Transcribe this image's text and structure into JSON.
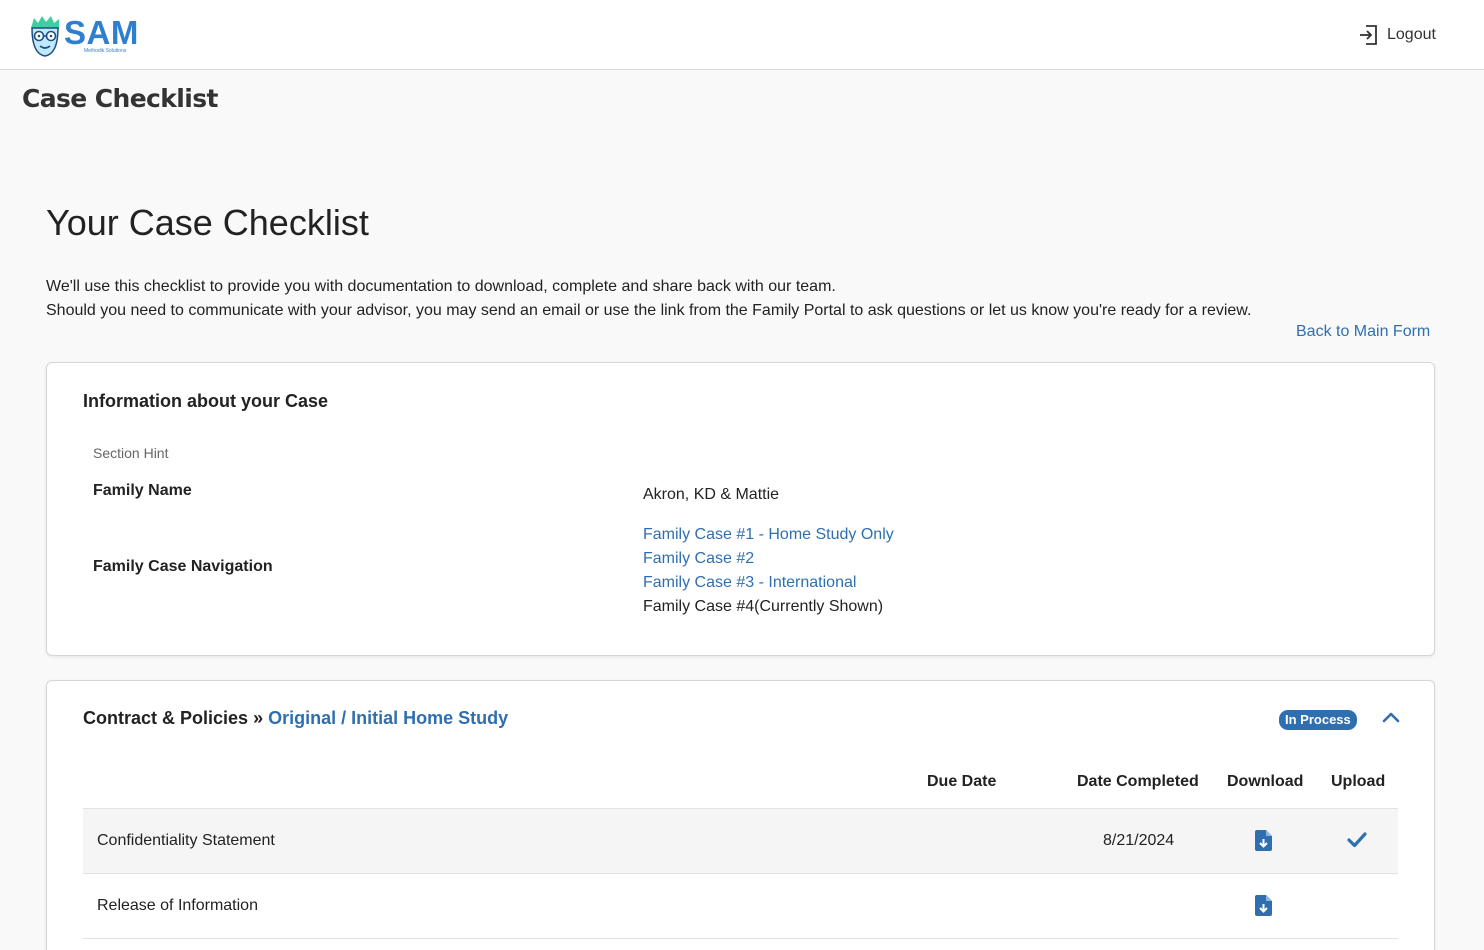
{
  "brand": {
    "name": "SAM",
    "tagline": "Methodik Solutions"
  },
  "header": {
    "logout_label": "Logout"
  },
  "page": {
    "title": "Case Checklist"
  },
  "main": {
    "heading": "Your Case Checklist",
    "intro_line1": "We'll use this checklist to provide you with documentation to download, complete and share back with our team.",
    "intro_line2": "Should you need to communicate with your advisor, you may send an email or use the link from the Family Portal to ask questions or let us know you're ready for a review.",
    "back_link": "Back to Main Form"
  },
  "info_card": {
    "title": "Information about your Case",
    "section_hint": "Section Hint",
    "family_name_label": "Family Name",
    "family_name_value": "Akron, KD & Mattie",
    "navigation_label": "Family Case Navigation",
    "cases": [
      "Family Case #1 - Home Study Only",
      "Family Case #2",
      "Family Case #3 - International",
      "Family Case #4(Currently Shown)"
    ]
  },
  "contract_section": {
    "title": "Contract & Policies",
    "separator": "»",
    "subtitle": "Original / Initial Home Study",
    "status": "In Process",
    "columns": {
      "due_date": "Due Date",
      "date_completed": "Date Completed",
      "download": "Download",
      "upload": "Upload"
    },
    "rows": [
      {
        "name": "Confidentiality Statement",
        "date_completed": "8/21/2024",
        "uploaded": true
      },
      {
        "name": "Release of Information",
        "date_completed": "",
        "uploaded": false
      }
    ]
  },
  "colors": {
    "accent": "#2f6fb0",
    "logo_blue": "#2f7fd1",
    "logo_hair": "#3ecfa0",
    "page_bg": "#f9f9f9"
  },
  "icons": {
    "logout": "logout-icon",
    "collapse": "chevron-up-icon",
    "download": "file-download-icon",
    "upload_done": "checkmark-icon"
  }
}
